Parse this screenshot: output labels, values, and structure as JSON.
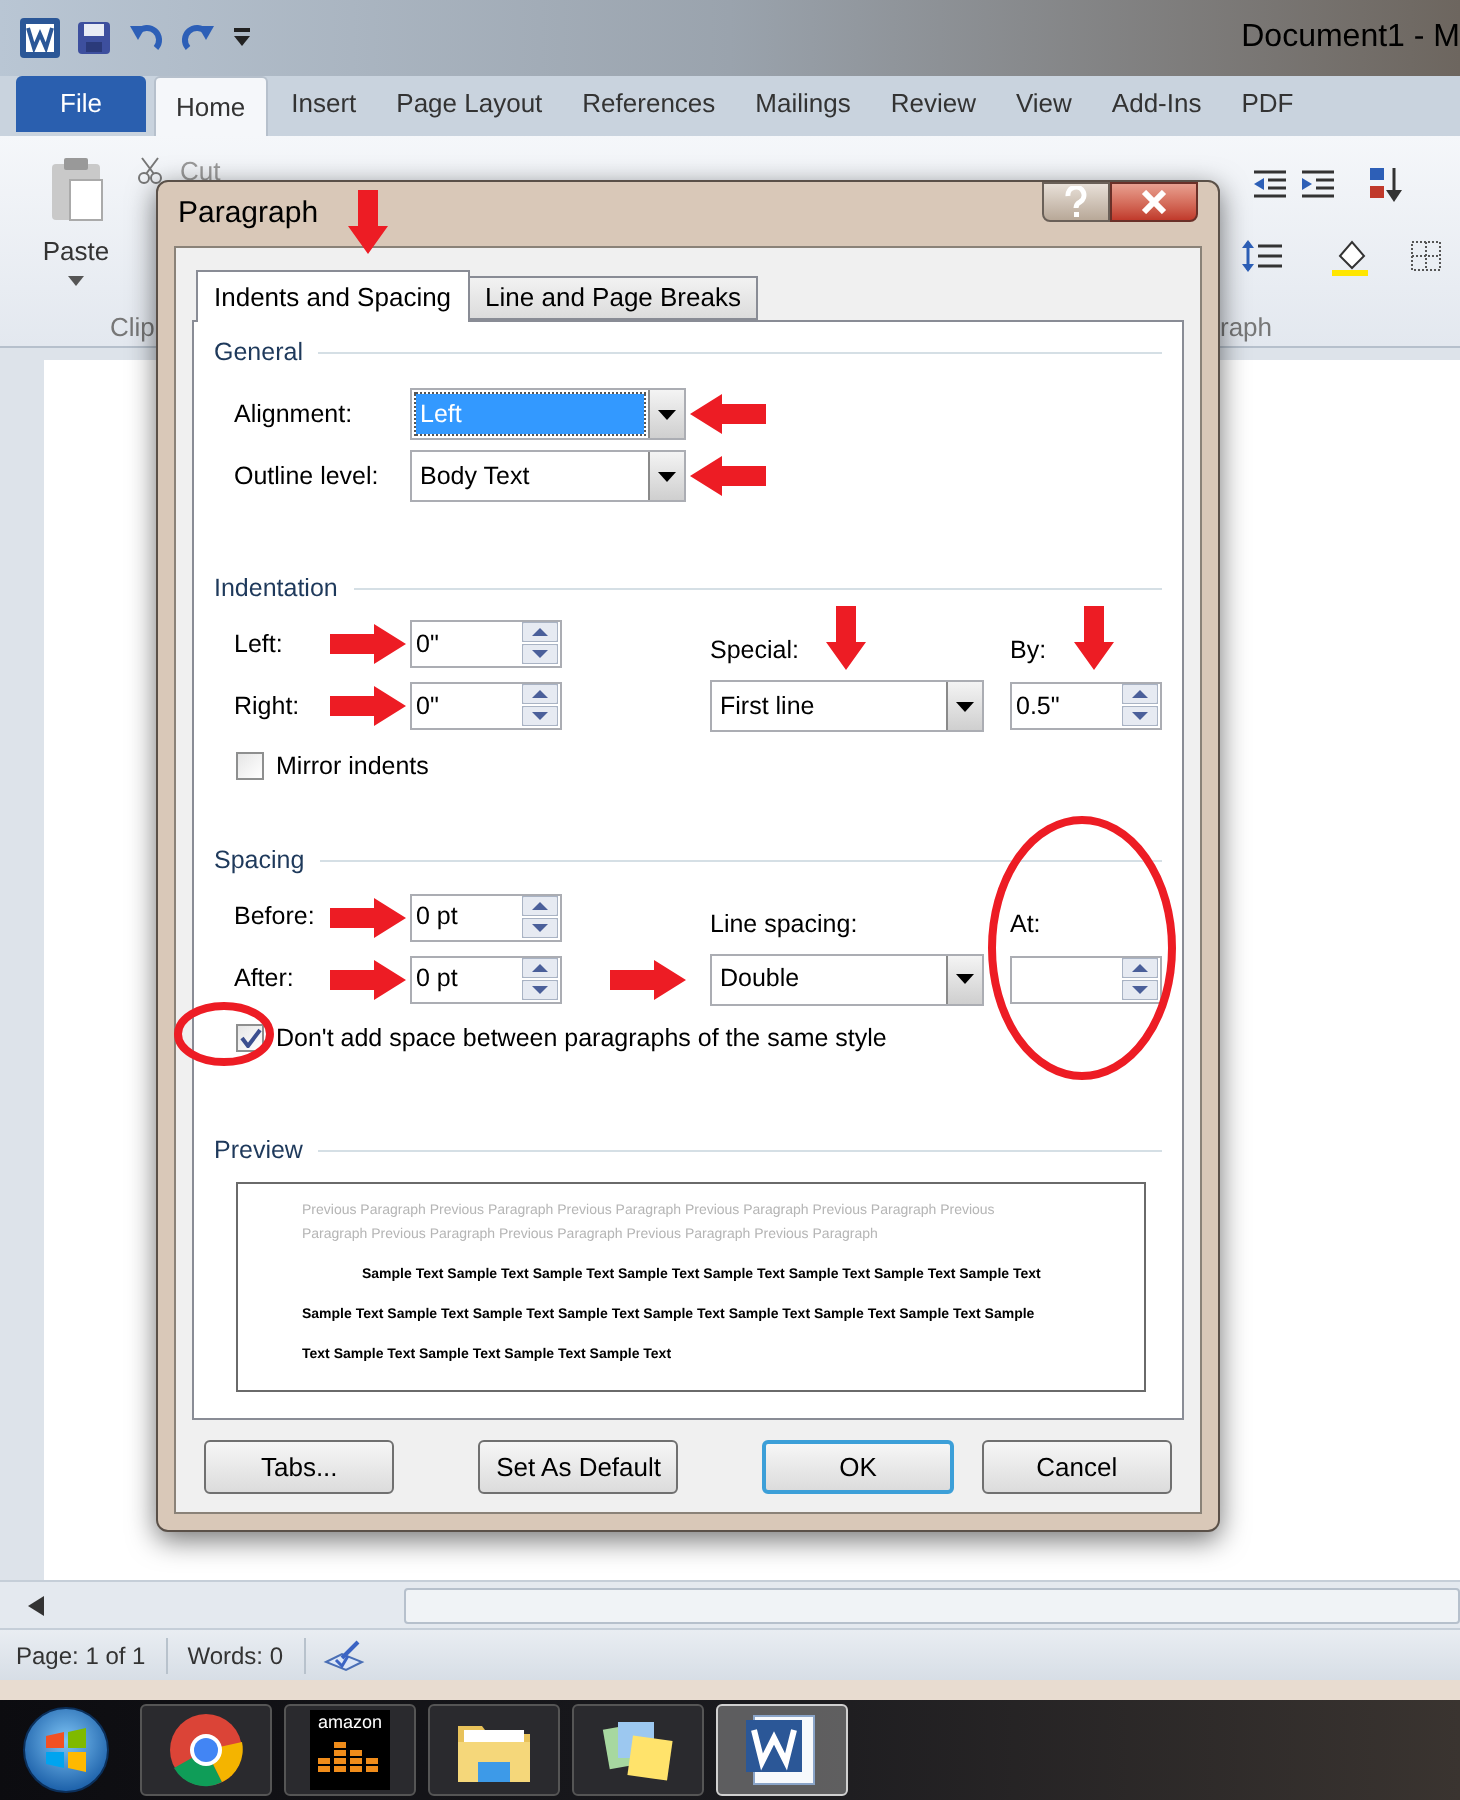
{
  "word_window": {
    "title": "Document1 - M",
    "tabs": [
      {
        "label": "File",
        "kind": "file",
        "selected": false
      },
      {
        "label": "Home",
        "kind": "tab",
        "selected": true
      },
      {
        "label": "Insert",
        "kind": "tab",
        "selected": false
      },
      {
        "label": "Page Layout",
        "kind": "tab",
        "selected": false
      },
      {
        "label": "References",
        "kind": "tab",
        "selected": false
      },
      {
        "label": "Mailings",
        "kind": "tab",
        "selected": false
      },
      {
        "label": "Review",
        "kind": "tab",
        "selected": false
      },
      {
        "label": "View",
        "kind": "tab",
        "selected": false
      },
      {
        "label": "Add-Ins",
        "kind": "tab",
        "selected": false
      },
      {
        "label": "PDF",
        "kind": "tab",
        "selected": false
      }
    ],
    "ribbon": {
      "paste": "Paste",
      "cut": "Cut",
      "clipboard_group": "Clip",
      "paragraph_group": "raph"
    }
  },
  "dialog": {
    "title": "Paragraph",
    "tabs": [
      {
        "label": "Indents and Spacing",
        "selected": true,
        "annotation": {
          "kind": "arrow_down"
        }
      },
      {
        "label": "Line and Page Breaks",
        "selected": false
      }
    ],
    "general": {
      "heading": "General",
      "alignment": {
        "label": "Alignment:",
        "value": "Left",
        "highlighted": true,
        "annotation": {
          "kind": "arrow_left"
        }
      },
      "outline_level": {
        "label": "Outline level:",
        "value": "Body Text",
        "highlighted": false,
        "annotation": {
          "kind": "arrow_left"
        }
      }
    },
    "indentation": {
      "heading": "Indentation",
      "left": {
        "label": "Left:",
        "value": "0\"",
        "annotation": {
          "kind": "arrow_right"
        }
      },
      "right": {
        "label": "Right:",
        "value": "0\"",
        "annotation": {
          "kind": "arrow_right"
        }
      },
      "special": {
        "label": "Special:",
        "value": "First line",
        "annotation": {
          "kind": "arrow_down"
        }
      },
      "by": {
        "label": "By:",
        "value": "0.5\"",
        "annotation": {
          "kind": "arrow_down"
        }
      },
      "mirror_indents": {
        "label": "Mirror indents",
        "checked": false
      }
    },
    "spacing": {
      "heading": "Spacing",
      "before": {
        "label": "Before:",
        "value": "0 pt",
        "annotation": {
          "kind": "arrow_right"
        }
      },
      "after": {
        "label": "After:",
        "value": "0 pt",
        "annotation": {
          "kind": "arrow_right"
        }
      },
      "line_spacing": {
        "label": "Line spacing:",
        "value": "Double",
        "annotation": {
          "kind": "arrow_right"
        }
      },
      "at": {
        "label": "At:",
        "annotation": {
          "kind": "circle"
        }
      },
      "no_space_same_style": {
        "label": "Don't add space between paragraphs of the same style",
        "checked": true,
        "annotation": {
          "kind": "circle"
        }
      }
    },
    "preview": {
      "heading": "Preview",
      "previous_paragraph": "Previous Paragraph Previous Paragraph Previous Paragraph Previous Paragraph Previous Paragraph Previous Paragraph Previous Paragraph Previous Paragraph Previous Paragraph Previous Paragraph",
      "sample_text": "Sample Text Sample Text Sample Text Sample Text Sample Text Sample Text Sample Text Sample Text Sample Text Sample Text Sample Text Sample Text Sample Text Sample Text Sample Text Sample Text Sample Text Sample Text Sample Text Sample Text Sample Text"
    },
    "buttons": [
      {
        "label": "Tabs...",
        "default": false
      },
      {
        "label": "Set As Default",
        "default": false
      },
      {
        "label": "OK",
        "default": true
      },
      {
        "label": "Cancel",
        "default": false
      }
    ]
  },
  "status_bar": {
    "page": "Page: 1 of 1",
    "words": "Words: 0"
  },
  "taskbar": {
    "apps": [
      {
        "kind": "chrome",
        "active": false
      },
      {
        "kind": "amazon",
        "label": "amazon",
        "active": false
      },
      {
        "kind": "folder",
        "active": false
      },
      {
        "kind": "notes",
        "active": false
      },
      {
        "kind": "word",
        "active": true
      }
    ]
  }
}
